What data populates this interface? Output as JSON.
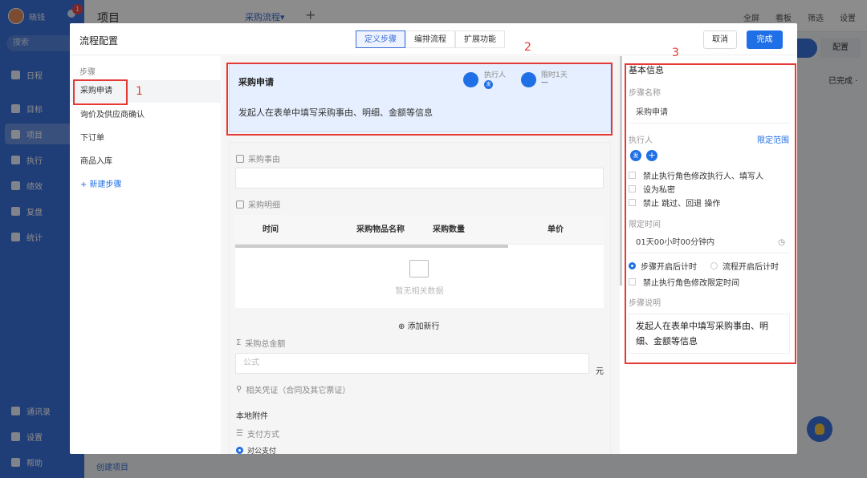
{
  "nav": {
    "user_name": "晓钱",
    "badge": "1",
    "search_placeholder": "搜索",
    "items": [
      {
        "label": "日程"
      },
      {
        "label": "目标"
      },
      {
        "label": "项目"
      },
      {
        "label": "执行"
      },
      {
        "label": "绩效"
      },
      {
        "label": "复盘"
      },
      {
        "label": "统计"
      }
    ],
    "bottom": [
      {
        "label": "通讯录"
      },
      {
        "label": "设置"
      },
      {
        "label": "帮助"
      }
    ]
  },
  "topbar": {
    "project": "项目",
    "flow_tab": "采购流程▾",
    "plus": "+",
    "actions": [
      "全屏",
      "看板",
      "筛选",
      "设置"
    ]
  },
  "background": {
    "config": "配置",
    "done_count": "已完成 ·",
    "create_project": "创建项目"
  },
  "modal": {
    "title": "流程配置",
    "tabs": [
      "定义步骤",
      "编排流程",
      "扩展功能"
    ],
    "cancel": "取消",
    "done": "完成"
  },
  "steps": {
    "header": "步骤",
    "items": [
      "采购申请",
      "询价及供应商确认",
      "下订单",
      "商品入库"
    ],
    "add": "+ 新建步骤"
  },
  "card": {
    "title": "采购申请",
    "executor_label": "执行人",
    "executor_tag": "发",
    "deadline_label": "限时1天",
    "deadline_value": "—",
    "desc": "发起人在表单中填写采购事由、明细、金额等信息"
  },
  "form": {
    "reason_label": "采购事由",
    "detail_label": "采购明细",
    "columns": [
      "时间",
      "采购物品名称",
      "采购数量",
      "单价"
    ],
    "empty": "暂无相关数据",
    "add_row": "添加新行",
    "total_label": "采购总金额",
    "total_placeholder": "公式",
    "unit": "元",
    "voucher_label": "相关凭证（合同及其它票证）",
    "local_attach": "本地附件",
    "pay_label": "支付方式",
    "pay_option": "对公支付"
  },
  "panel": {
    "basic": "基本信息",
    "step_name_label": "步骤名称",
    "step_name": "采购申请",
    "executor_label": "执行人",
    "limit_range": "限定范围",
    "executor_tag": "发",
    "add": "+",
    "checks": [
      "禁止执行角色修改执行人、填写人",
      "设为私密",
      "禁止 跳过、回退 操作"
    ],
    "time_label": "限定时间",
    "time_value": "01天00小时00分钟内",
    "radio_a": "步骤开启后计时",
    "radio_b": "流程开启后计时",
    "time_check": "禁止执行角色修改限定时间",
    "desc_label": "步骤说明",
    "desc": "发起人在表单中填写采购事由、明细、金额等信息"
  },
  "annotations": [
    "1",
    "2",
    "3"
  ]
}
